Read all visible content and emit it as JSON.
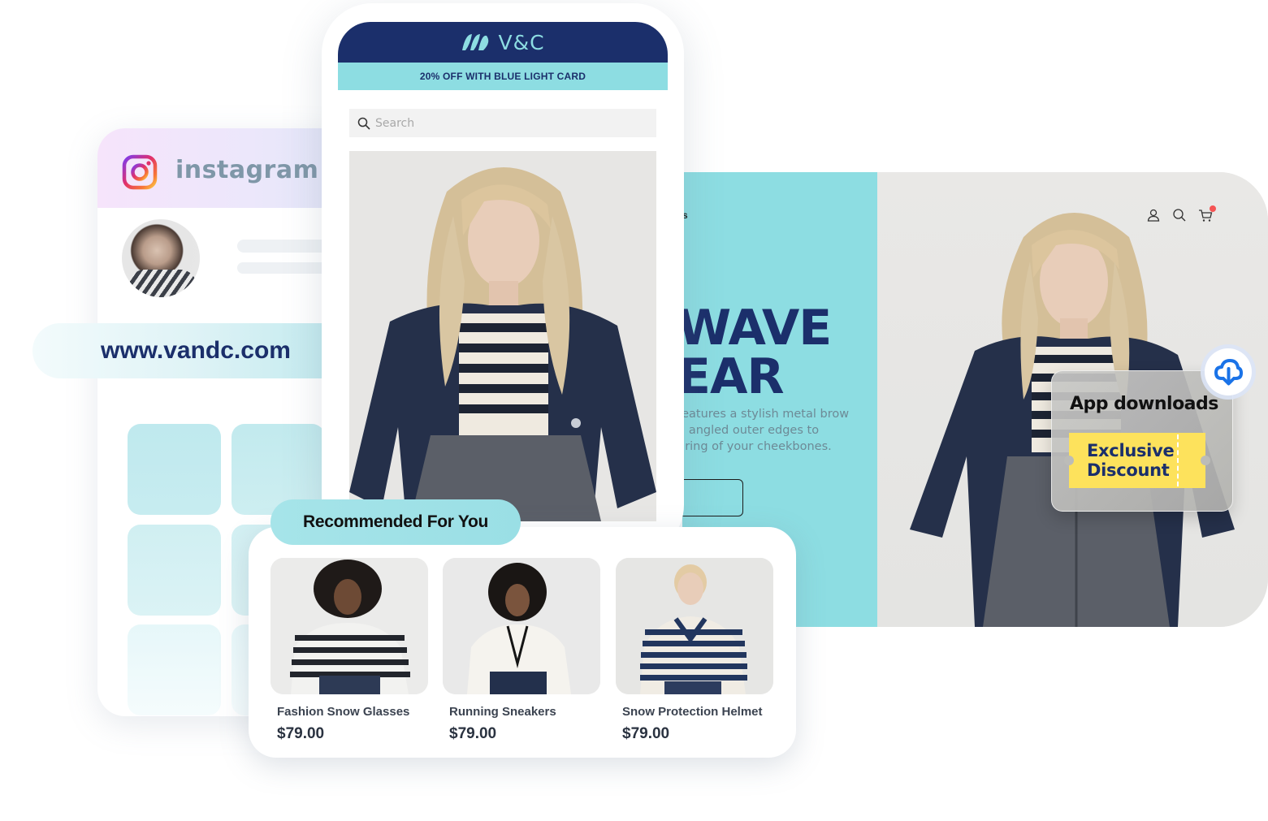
{
  "instagram": {
    "wordmark": "instagram",
    "icon": "instagram-logo-icon",
    "avatar_alt": "profile-photo",
    "tile_colors": [
      "#bfe9ee",
      "#c4ebef",
      "#d3f0f3",
      "#d6f1f4",
      "#e6f7f9",
      "#eaf8fa"
    ]
  },
  "url_pill": {
    "text": "www.vandc.com"
  },
  "phone": {
    "brand": "V&C",
    "promo": "20% OFF WITH BLUE LIGHT CARD",
    "search": {
      "placeholder": "Search",
      "value": ""
    }
  },
  "desktop": {
    "nav_fragment": "s",
    "headline_line1": "WAVE",
    "headline_line2": "EAR",
    "body_line1": "features a stylish metal brow",
    "body_line2": "d angled outer edges to",
    "body_line3": "uring of your cheekbones.",
    "cta_label": "",
    "icons": [
      "user-icon",
      "search-icon",
      "cart-icon"
    ],
    "cart_badge": true
  },
  "app_badge": {
    "title": "App downloads",
    "ticket_line1": "Exclusive",
    "ticket_line2": "Discount",
    "icon": "cloud-download-icon"
  },
  "recommended": {
    "title": "Recommended For You",
    "products": [
      {
        "name": "Fashion Snow Glasses",
        "price": "$79.00"
      },
      {
        "name": "Running Sneakers",
        "price": "$79.00"
      },
      {
        "name": "Snow Protection Helmet",
        "price": "$79.00"
      }
    ]
  },
  "colors": {
    "navy": "#1b2f6b",
    "teal": "#8ddde2",
    "yellow": "#fde25c",
    "cart_badge": "#f55454",
    "download_blue": "#1a73e8"
  }
}
